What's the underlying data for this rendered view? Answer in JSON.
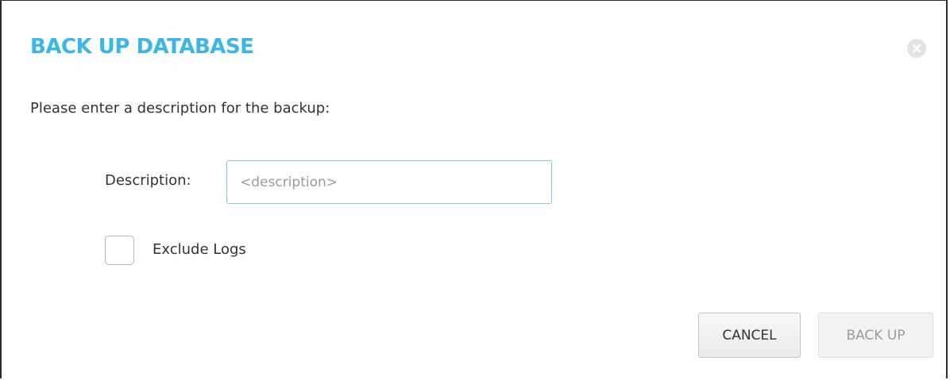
{
  "dialog": {
    "title": "BACK UP DATABASE",
    "close_icon": "close-icon",
    "instructions": "Please enter a description for the backup:",
    "description": {
      "label": "Description:",
      "value": "",
      "placeholder": "<description>"
    },
    "exclude_logs": {
      "label": "Exclude Logs",
      "checked": false
    },
    "buttons": {
      "cancel": "CANCEL",
      "backup": "BACK UP"
    }
  },
  "colors": {
    "title": "#39b7e6",
    "input_border": "#7fcdee",
    "disabled_text": "#9c9c9c"
  }
}
